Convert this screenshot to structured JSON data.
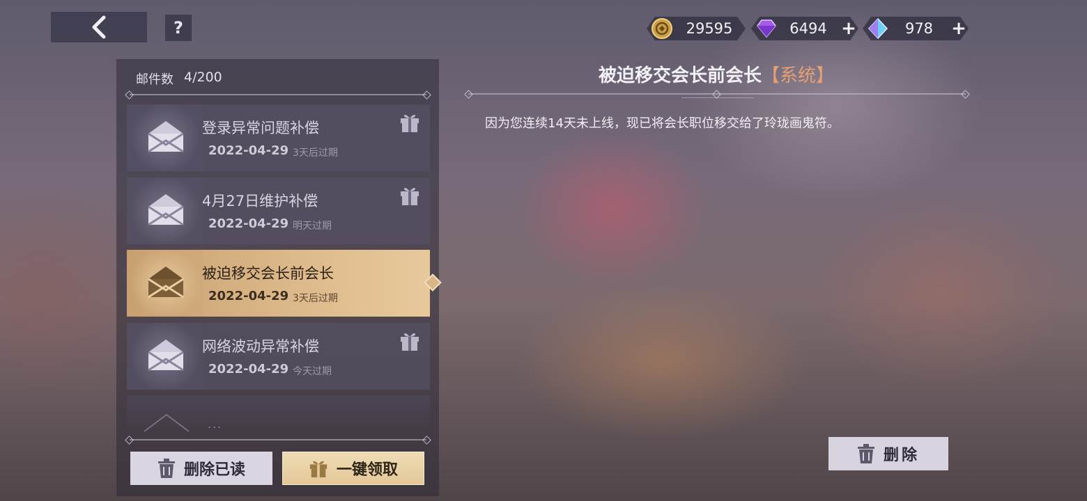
{
  "header": {
    "back_icon": "chevron-left-icon",
    "help_label": "?"
  },
  "currencies": [
    {
      "name": "gold-coin",
      "icon": "coin-icon",
      "value": "29595",
      "has_plus": false,
      "color": "#e2b24a"
    },
    {
      "name": "purple-gem",
      "icon": "purple-diamond-icon",
      "value": "6494",
      "has_plus": true,
      "plus": "+",
      "color": "#b66cf0"
    },
    {
      "name": "blue-crystal",
      "icon": "blue-crystal-icon",
      "value": "978",
      "has_plus": true,
      "plus": "+",
      "color": "#6ad0f3"
    }
  ],
  "mailbox": {
    "count_label": "邮件数",
    "count_value": "4/200",
    "more_indicator": "...",
    "items": [
      {
        "title": "登录异常问题补偿",
        "date": "2022-04-29",
        "expiry": "3天后过期",
        "has_gift": true,
        "selected": false
      },
      {
        "title": "4月27日维护补偿",
        "date": "2022-04-29",
        "expiry": "明天过期",
        "has_gift": true,
        "selected": false
      },
      {
        "title": "被迫移交会长前会长",
        "date": "2022-04-29",
        "expiry": "3天后过期",
        "has_gift": false,
        "selected": true
      },
      {
        "title": "网络波动异常补偿",
        "date": "2022-04-29",
        "expiry": "今天过期",
        "has_gift": true,
        "selected": false
      }
    ],
    "delete_read_label": "删除已读",
    "claim_all_label": "一键领取"
  },
  "detail": {
    "title": "被迫移交会长前会长",
    "tag": "【系统】",
    "body": "因为您连续14天未上线，现已将会长职位移交给了玲珑画鬼符。",
    "delete_label": "删除"
  },
  "colors": {
    "accent_gold": "#dcb98a",
    "tag_orange": "#e6a071"
  }
}
